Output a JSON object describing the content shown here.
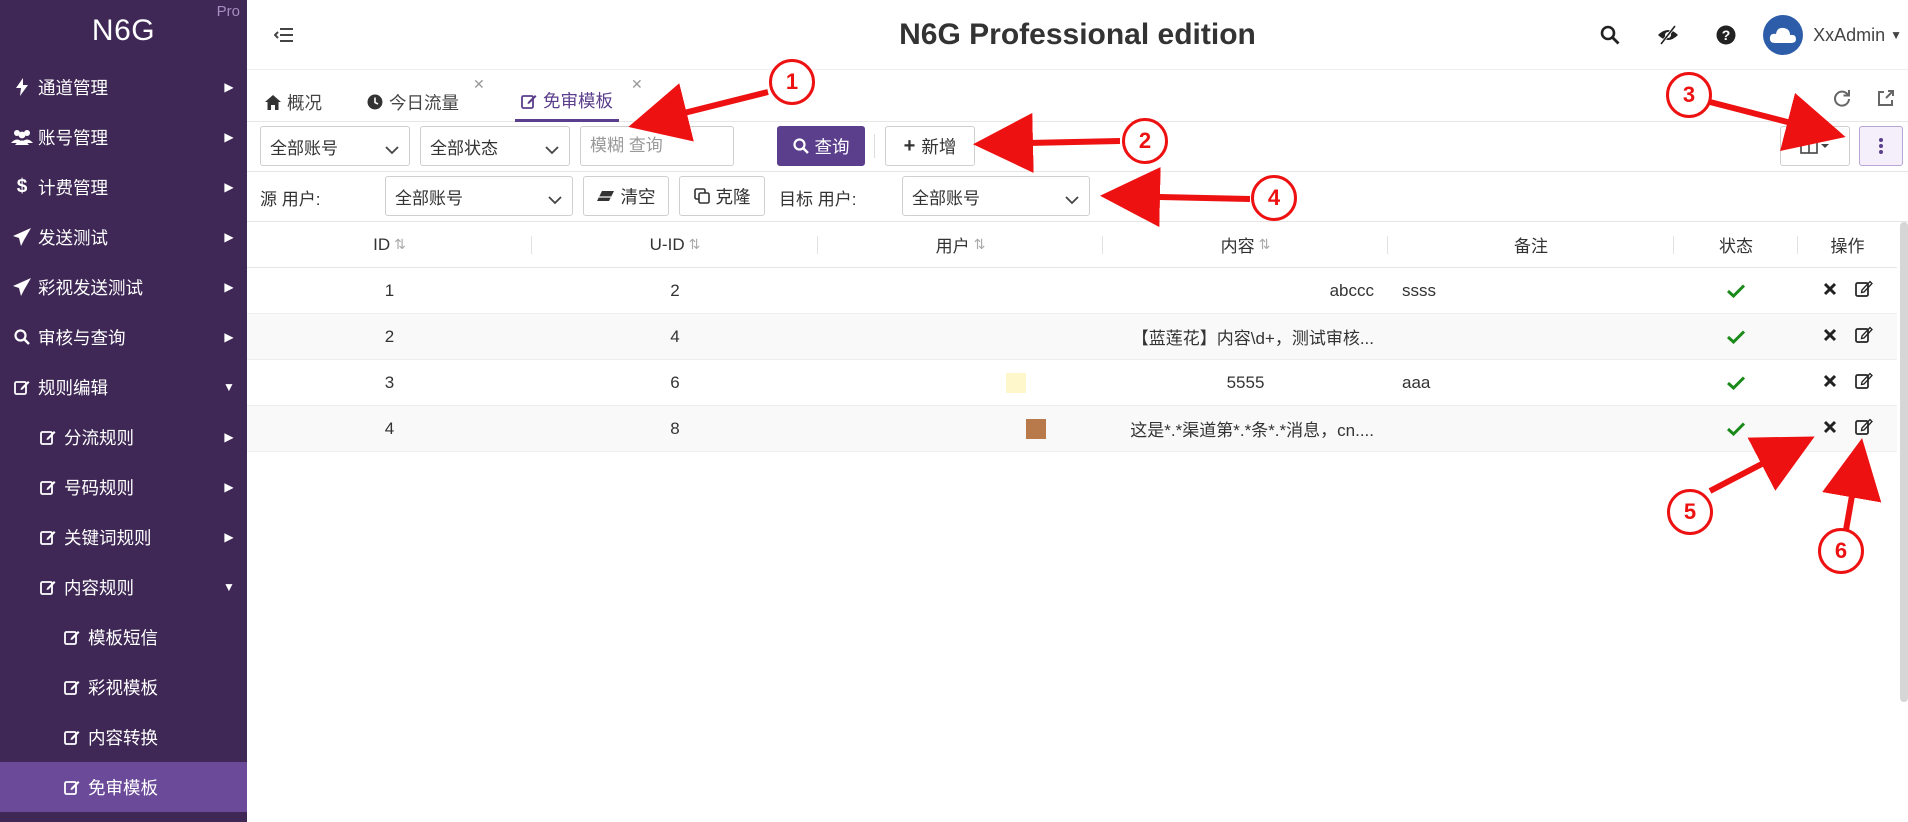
{
  "sidebar": {
    "logo": "N6G",
    "badge": "Pro",
    "items": [
      {
        "label": "通道管理",
        "icon": "bolt-icon",
        "arrow": "right"
      },
      {
        "label": "账号管理",
        "icon": "users-icon",
        "arrow": "right"
      },
      {
        "label": "计费管理",
        "icon": "dollar-icon",
        "arrow": "right"
      },
      {
        "label": "发送测试",
        "icon": "paper-plane-icon",
        "arrow": "right"
      },
      {
        "label": "彩视发送测试",
        "icon": "paper-plane-icon",
        "arrow": "right"
      },
      {
        "label": "审核与查询",
        "icon": "search-icon",
        "arrow": "right"
      },
      {
        "label": "规则编辑",
        "icon": "edit-icon",
        "arrow": "down"
      }
    ],
    "sub_items": [
      {
        "label": "分流规则",
        "arrow": "right"
      },
      {
        "label": "号码规则",
        "arrow": "right"
      },
      {
        "label": "关键词规则",
        "arrow": "right"
      },
      {
        "label": "内容规则",
        "arrow": "down"
      }
    ],
    "sub_sub_items": [
      {
        "label": "模板短信"
      },
      {
        "label": "彩视模板"
      },
      {
        "label": "内容转换"
      },
      {
        "label": "免审模板",
        "active": true
      }
    ]
  },
  "header": {
    "title": "N6G Professional edition",
    "username": "XxAdmin"
  },
  "tabs": [
    {
      "label": "概况",
      "icon": "home-icon"
    },
    {
      "label": "今日流量",
      "icon": "clock-icon",
      "closable": true
    },
    {
      "label": "免审模板",
      "icon": "edit-icon",
      "closable": true,
      "active": true
    }
  ],
  "toolbar": {
    "account_select": "全部账号",
    "status_select": "全部状态",
    "search_placeholder": "模糊 查询",
    "query_label": "查询",
    "add_label": "新增"
  },
  "filter": {
    "source_label": "源 用户:",
    "source_select": "全部账号",
    "clear_label": "清空",
    "clone_label": "克隆",
    "target_label": "目标 用户:",
    "target_select": "全部账号"
  },
  "table": {
    "columns": [
      "ID",
      "U-ID",
      "用户",
      "内容",
      "备注",
      "状态",
      "操作"
    ],
    "rows": [
      {
        "id": "1",
        "uid": "2",
        "user": "",
        "content": "abccc",
        "note": "ssss"
      },
      {
        "id": "2",
        "uid": "4",
        "user": "",
        "content": "【蓝莲花】内容\\d+，测试审核...",
        "note": ""
      },
      {
        "id": "3",
        "uid": "6",
        "user": "",
        "content": "5555",
        "note": "aaa"
      },
      {
        "id": "4",
        "uid": "8",
        "user": "",
        "content": "这是*.*渠道第*.*条*.*消息，cn....",
        "note": ""
      }
    ]
  },
  "callouts": [
    "1",
    "2",
    "3",
    "4",
    "5",
    "6"
  ],
  "colors": {
    "sidebar_bg": "#3f2856",
    "sidebar_active": "#6b4a9a",
    "primary": "#5b3f8c",
    "status_ok": "#1a8a1a",
    "annotation_red": "#ee1111",
    "user_swatch_3": "#fff7cc",
    "user_swatch_4": "#b87a4a"
  }
}
